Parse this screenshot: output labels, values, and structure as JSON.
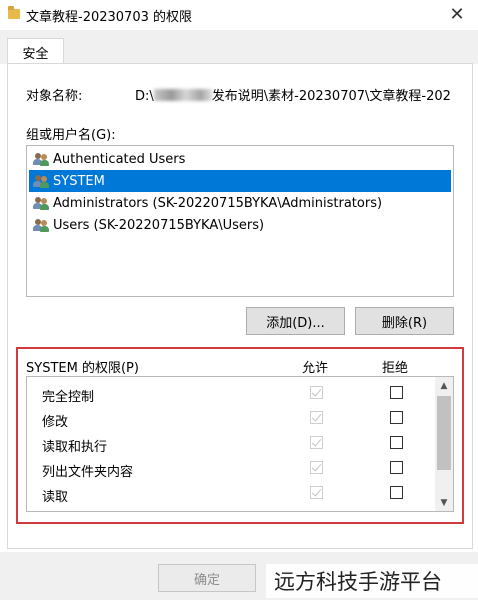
{
  "window": {
    "title": "文章教程-20230703 的权限",
    "close_glyph": "✕"
  },
  "tabs": [
    {
      "label": "安全"
    }
  ],
  "object_name": {
    "label": "对象名称:",
    "value_prefix": "D:\\",
    "value_suffix": "发布说明\\素材-20230707\\文章教程-202"
  },
  "groups": {
    "label": "组或用户名(G):",
    "items": [
      {
        "label": "Authenticated Users"
      },
      {
        "label": "SYSTEM"
      },
      {
        "label": "Administrators (SK-20220715BYKA\\Administrators)"
      },
      {
        "label": "Users (SK-20220715BYKA\\Users)"
      }
    ],
    "selected_index": 1
  },
  "buttons": {
    "add": "添加(D)...",
    "remove": "删除(R)",
    "ok": "确定"
  },
  "permissions": {
    "title": "SYSTEM 的权限(P)",
    "allow_header": "允许",
    "deny_header": "拒绝",
    "rows": [
      {
        "name": "完全控制",
        "allow": true,
        "deny": false
      },
      {
        "name": "修改",
        "allow": true,
        "deny": false
      },
      {
        "name": "读取和执行",
        "allow": true,
        "deny": false
      },
      {
        "name": "列出文件夹内容",
        "allow": true,
        "deny": false
      },
      {
        "name": "读取",
        "allow": true,
        "deny": false
      }
    ]
  },
  "watermark": "远方科技手游平台",
  "colors": {
    "selection": "#0078d7",
    "highlight_border": "#d33a3e"
  }
}
